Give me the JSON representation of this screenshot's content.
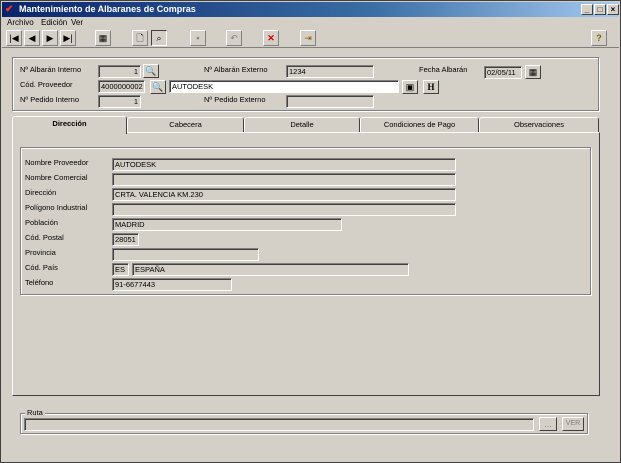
{
  "window": {
    "title": "Mantenimiento de Albaranes de Compras",
    "min_glyph": "_",
    "max_glyph": "□",
    "close_glyph": "×"
  },
  "menu": {
    "items": [
      {
        "label": "Archivo"
      },
      {
        "label": "Edición"
      },
      {
        "label": "Ver"
      }
    ]
  },
  "toolbar": {
    "icons": [
      "first-record-icon",
      "prev-record-icon",
      "next-record-icon",
      "last-record-icon",
      "calendar-grid-icon",
      "new-document-icon",
      "find-icon",
      "save-icon",
      "undo-icon",
      "delete-icon",
      "exit-icon",
      "help-icon"
    ]
  },
  "header": {
    "albaran_interno": {
      "label": "Nº Albarán Interno",
      "value": "1"
    },
    "albaran_externo": {
      "label": "Nº Albarán Externo",
      "value": "1234"
    },
    "fecha_albaran": {
      "label": "Fecha Albarán",
      "value": "02/05/11"
    },
    "cod_proveedor": {
      "label": "Cód. Proveedor",
      "value": "4000000002",
      "name_value": "AUTODESK"
    },
    "pedido_interno": {
      "label": "Nº Pedido Interno",
      "value": "1"
    },
    "pedido_externo": {
      "label": "Nº Pedido Externo",
      "value": ""
    },
    "h_button_label": "H"
  },
  "tabs": [
    {
      "label": "Dirección",
      "active": true
    },
    {
      "label": "Cabecera",
      "active": false
    },
    {
      "label": "Detalle",
      "active": false
    },
    {
      "label": "Condiciones de Pago",
      "active": false
    },
    {
      "label": "Observaciones",
      "active": false
    }
  ],
  "direccion": {
    "nombre_proveedor": {
      "label": "Nombre Proveedor",
      "value": "AUTODESK"
    },
    "nombre_comercial": {
      "label": "Nombre Comercial",
      "value": ""
    },
    "direccion": {
      "label": "Dirección",
      "value": "CRTA. VALENCIA KM.230"
    },
    "poligono": {
      "label": "Polígono Industrial",
      "value": ""
    },
    "poblacion": {
      "label": "Población",
      "value": "MADRID"
    },
    "cod_postal": {
      "label": "Cód. Postal",
      "value": "28051"
    },
    "provincia": {
      "label": "Provincia",
      "value": ""
    },
    "cod_pais": {
      "label": "Cód. País",
      "code": "ES",
      "name": "ESPAÑA"
    },
    "telefono": {
      "label": "Teléfono",
      "value": "91-6677443"
    }
  },
  "ruta": {
    "label": "Ruta",
    "value": "",
    "browse_label": "...",
    "ver_label": "VER"
  }
}
